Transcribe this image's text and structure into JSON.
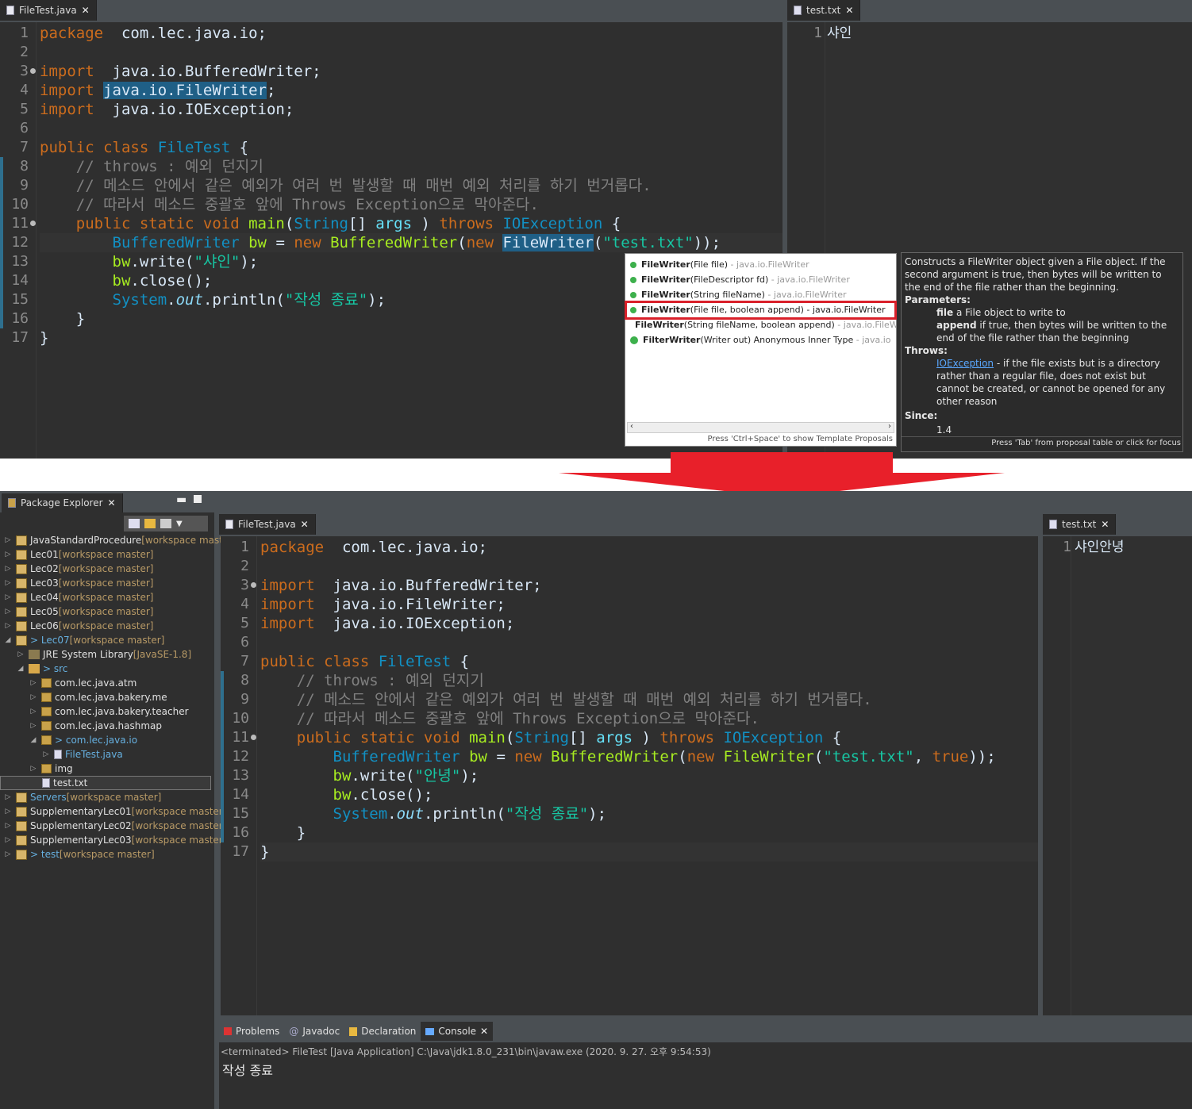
{
  "top": {
    "editor_tab": "FileTest.java",
    "text_tab": "test.txt",
    "text_content_line": "1",
    "text_content": "샤인",
    "code": [
      {
        "n": "1",
        "h": [
          [
            "kw",
            "package"
          ],
          [
            "",
            "  com.lec.java.io;"
          ]
        ]
      },
      {
        "n": "2",
        "h": []
      },
      {
        "n": "3",
        "h": [
          [
            "kw",
            "import"
          ],
          [
            "",
            "  java.io.BufferedWriter;"
          ]
        ]
      },
      {
        "n": "4",
        "h": [
          [
            "kw",
            "import"
          ],
          [
            "",
            " "
          ],
          [
            "hl",
            "java.io.FileWriter"
          ],
          [
            "",
            ";"
          ]
        ]
      },
      {
        "n": "5",
        "h": [
          [
            "kw",
            "import"
          ],
          [
            "",
            "  java.io.IOException;"
          ]
        ]
      },
      {
        "n": "6",
        "h": []
      },
      {
        "n": "7",
        "h": [
          [
            "kw",
            "public class "
          ],
          [
            "ty",
            "FileTest"
          ],
          [
            "",
            " {"
          ]
        ]
      },
      {
        "n": "8",
        "h": [
          [
            "cm",
            "    // throws : 예외 던지기"
          ]
        ]
      },
      {
        "n": "9",
        "h": [
          [
            "cm",
            "    // 메소드 안에서 같은 예외가 여러 번 발생할 때 매번 예외 처리를 하기 번거롭다."
          ]
        ]
      },
      {
        "n": "10",
        "h": [
          [
            "cm",
            "    // 따라서 메소드 중괄호 앞에 Throws Exception으로 막아준다."
          ]
        ]
      },
      {
        "n": "11",
        "h": [
          [
            "kw",
            "    public static void "
          ],
          [
            "fn",
            "main"
          ],
          [
            "",
            "("
          ],
          [
            "ty",
            "String"
          ],
          [
            "",
            "[] "
          ],
          [
            "var",
            "args"
          ],
          [
            "",
            " ) "
          ],
          [
            "kw",
            "throws "
          ],
          [
            "ty",
            "IOException"
          ],
          [
            "",
            " {"
          ]
        ]
      },
      {
        "n": "12",
        "h": [
          [
            "ty",
            "        BufferedWriter "
          ],
          [
            "fn",
            "bw"
          ],
          [
            "",
            " = "
          ],
          [
            "kw",
            "new "
          ],
          [
            "fn",
            "BufferedWriter"
          ],
          [
            "",
            "("
          ],
          [
            "kw",
            "new "
          ],
          [
            "hl",
            "FileWriter"
          ],
          [
            "",
            "("
          ],
          [
            "st",
            "\"test.txt\""
          ],
          [
            "",
            "));"
          ]
        ]
      },
      {
        "n": "13",
        "h": [
          [
            "fn",
            "        bw"
          ],
          [
            "",
            ".write("
          ],
          [
            "st",
            "\"샤인\""
          ],
          [
            "",
            ");"
          ]
        ]
      },
      {
        "n": "14",
        "h": [
          [
            "fn",
            "        bw"
          ],
          [
            "",
            ".close();"
          ]
        ]
      },
      {
        "n": "15",
        "h": [
          [
            "ty",
            "        System"
          ],
          [
            "",
            "."
          ],
          [
            "it",
            "out"
          ],
          [
            "",
            ".println("
          ],
          [
            "st",
            "\"작성 종료\""
          ],
          [
            "",
            ");"
          ]
        ]
      },
      {
        "n": "16",
        "h": [
          [
            "",
            "    }"
          ]
        ]
      },
      {
        "n": "17",
        "h": [
          [
            "",
            "}"
          ]
        ]
      }
    ],
    "proposals": [
      {
        "b": "FileWriter",
        "r": "(File file)",
        "g": " - java.io.FileWriter"
      },
      {
        "b": "FileWriter",
        "r": "(FileDescriptor fd)",
        "g": " - java.io.FileWriter"
      },
      {
        "b": "FileWriter",
        "r": "(String fileName)",
        "g": " - java.io.FileWriter"
      },
      {
        "b": "FileWriter",
        "r": "(File file, boolean append) - java.io.FileWriter",
        "g": ""
      },
      {
        "b": "FileWriter",
        "r": "(String fileName, boolean append)",
        "g": " - java.io.FileW"
      },
      {
        "b": "FilterWriter",
        "r": "(Writer out)  Anonymous Inner Type",
        "g": " - java.io"
      }
    ],
    "proposals_footer": "Press 'Ctrl+Space' to show Template Proposals",
    "doc": {
      "intro": "Constructs a FileWriter object given a File object. If the second argument is true, then bytes will be written to the end of the file rather than the beginning.",
      "params_label": "Parameters:",
      "p1_name": "file",
      "p1_desc": " a File object to write to",
      "p2_name": "append",
      "p2_desc": " if true, then bytes will be written to the end of the file rather than the beginning",
      "throws_label": "Throws:",
      "throws_link": "IOException",
      "throws_desc": " - if the file exists but is a directory rather than a regular file, does not exist but cannot be created, or cannot be opened for any other reason",
      "since_label": "Since:",
      "since_val": "1.4",
      "footer": "Press 'Tab' from proposal table or click for focus"
    }
  },
  "bottom": {
    "explorer_tab": "Package Explorer",
    "editor_tab": "FileTest.java",
    "text_tab": "test.txt",
    "text_content_line": "1",
    "text_content": "샤인안녕",
    "tree": [
      {
        "d": 0,
        "t": "proj",
        "a": "▷",
        "n": "JavaStandardProcedure",
        "s": " [workspace maste"
      },
      {
        "d": 0,
        "t": "proj",
        "a": "▷",
        "n": "Lec01",
        "s": " [workspace master]"
      },
      {
        "d": 0,
        "t": "proj",
        "a": "▷",
        "n": "Lec02",
        "s": " [workspace master]"
      },
      {
        "d": 0,
        "t": "proj",
        "a": "▷",
        "n": "Lec03",
        "s": " [workspace master]"
      },
      {
        "d": 0,
        "t": "proj",
        "a": "▷",
        "n": "Lec04",
        "s": " [workspace master]"
      },
      {
        "d": 0,
        "t": "proj",
        "a": "▷",
        "n": "Lec05",
        "s": " [workspace master]"
      },
      {
        "d": 0,
        "t": "proj",
        "a": "▷",
        "n": "Lec06",
        "s": " [workspace master]"
      },
      {
        "d": 0,
        "t": "proj",
        "a": "◢",
        "n": "> Lec07",
        "s": " [workspace master]",
        "c": 1
      },
      {
        "d": 1,
        "t": "lib",
        "a": "▷",
        "n": "JRE System Library",
        "s": " [JavaSE-1.8]"
      },
      {
        "d": 1,
        "t": "src",
        "a": "◢",
        "n": "> src",
        "s": "",
        "c": 1
      },
      {
        "d": 2,
        "t": "pkg",
        "a": "▷",
        "n": "com.lec.java.atm",
        "s": ""
      },
      {
        "d": 2,
        "t": "pkg",
        "a": "▷",
        "n": "com.lec.java.bakery.me",
        "s": ""
      },
      {
        "d": 2,
        "t": "pkg",
        "a": "▷",
        "n": "com.lec.java.bakery.teacher",
        "s": ""
      },
      {
        "d": 2,
        "t": "pkg",
        "a": "▷",
        "n": "com.lec.java.hashmap",
        "s": ""
      },
      {
        "d": 2,
        "t": "pkg",
        "a": "◢",
        "n": "> com.lec.java.io",
        "s": "",
        "c": 1
      },
      {
        "d": 3,
        "t": "file",
        "a": "▷",
        "n": "FileTest.java",
        "s": "",
        "c": 1
      },
      {
        "d": 2,
        "t": "pkg",
        "a": "▷",
        "n": "img",
        "s": ""
      },
      {
        "d": 2,
        "t": "file",
        "a": "",
        "n": "test.txt",
        "s": "",
        "sel": 1
      },
      {
        "d": 0,
        "t": "proj",
        "a": "▷",
        "n": "Servers",
        "s": " [workspace master]",
        "c": 1
      },
      {
        "d": 0,
        "t": "proj",
        "a": "▷",
        "n": "SupplementaryLec01",
        "s": " [workspace master]"
      },
      {
        "d": 0,
        "t": "proj",
        "a": "▷",
        "n": "SupplementaryLec02",
        "s": " [workspace master]"
      },
      {
        "d": 0,
        "t": "proj",
        "a": "▷",
        "n": "SupplementaryLec03",
        "s": " [workspace master]"
      },
      {
        "d": 0,
        "t": "proj",
        "a": "▷",
        "n": "> test",
        "s": " [workspace master]",
        "c": 1
      }
    ],
    "code": [
      {
        "n": "1",
        "h": [
          [
            "kw",
            "package"
          ],
          [
            "",
            "  com.lec.java.io;"
          ]
        ]
      },
      {
        "n": "2",
        "h": []
      },
      {
        "n": "3",
        "h": [
          [
            "kw",
            "import"
          ],
          [
            "",
            "  java.io.BufferedWriter;"
          ]
        ]
      },
      {
        "n": "4",
        "h": [
          [
            "kw",
            "import"
          ],
          [
            "",
            "  java.io.FileWriter;"
          ]
        ]
      },
      {
        "n": "5",
        "h": [
          [
            "kw",
            "import"
          ],
          [
            "",
            "  java.io.IOException;"
          ]
        ]
      },
      {
        "n": "6",
        "h": []
      },
      {
        "n": "7",
        "h": [
          [
            "kw",
            "public class "
          ],
          [
            "ty",
            "FileTest"
          ],
          [
            "",
            " {"
          ]
        ]
      },
      {
        "n": "8",
        "h": [
          [
            "cm",
            "    // throws : 예외 던지기"
          ]
        ]
      },
      {
        "n": "9",
        "h": [
          [
            "cm",
            "    // 메소드 안에서 같은 예외가 여러 번 발생할 때 매번 예외 처리를 하기 번거롭다."
          ]
        ]
      },
      {
        "n": "10",
        "h": [
          [
            "cm",
            "    // 따라서 메소드 중괄호 앞에 Throws Exception으로 막아준다."
          ]
        ]
      },
      {
        "n": "11",
        "h": [
          [
            "kw",
            "    public static void "
          ],
          [
            "fn",
            "main"
          ],
          [
            "",
            "("
          ],
          [
            "ty",
            "String"
          ],
          [
            "",
            "[] "
          ],
          [
            "var",
            "args"
          ],
          [
            "",
            " ) "
          ],
          [
            "kw",
            "throws "
          ],
          [
            "ty",
            "IOException"
          ],
          [
            "",
            " {"
          ]
        ]
      },
      {
        "n": "12",
        "h": [
          [
            "ty",
            "        BufferedWriter "
          ],
          [
            "fn",
            "bw"
          ],
          [
            "",
            " = "
          ],
          [
            "kw",
            "new "
          ],
          [
            "fn",
            "BufferedWriter"
          ],
          [
            "",
            "("
          ],
          [
            "kw",
            "new "
          ],
          [
            "fn",
            "FileWriter"
          ],
          [
            "",
            "("
          ],
          [
            "st",
            "\"test.txt\""
          ],
          [
            "",
            ", "
          ],
          [
            "kw",
            "true"
          ],
          [
            "",
            "));"
          ]
        ]
      },
      {
        "n": "13",
        "h": [
          [
            "fn",
            "        bw"
          ],
          [
            "",
            ".write("
          ],
          [
            "st",
            "\"안녕\""
          ],
          [
            "",
            ");"
          ]
        ]
      },
      {
        "n": "14",
        "h": [
          [
            "fn",
            "        bw"
          ],
          [
            "",
            ".close();"
          ]
        ]
      },
      {
        "n": "15",
        "h": [
          [
            "ty",
            "        System"
          ],
          [
            "",
            "."
          ],
          [
            "it",
            "out"
          ],
          [
            "",
            ".println("
          ],
          [
            "st",
            "\"작성 종료\""
          ],
          [
            "",
            ");"
          ]
        ]
      },
      {
        "n": "16",
        "h": [
          [
            "",
            "    }"
          ]
        ]
      },
      {
        "n": "17",
        "h": [
          [
            "",
            "}"
          ]
        ]
      }
    ],
    "bottom_tabs": [
      "Problems",
      "Javadoc",
      "Declaration",
      "Console"
    ],
    "console_header": "<terminated> FileTest [Java Application] C:\\Java\\jdk1.8.0_231\\bin\\javaw.exe (2020. 9. 27. 오후 9:54:53)",
    "console_output": "작성 종료"
  },
  "colors": {
    "arrow": "#e8202a",
    "highlight_box": "#d9202a"
  }
}
